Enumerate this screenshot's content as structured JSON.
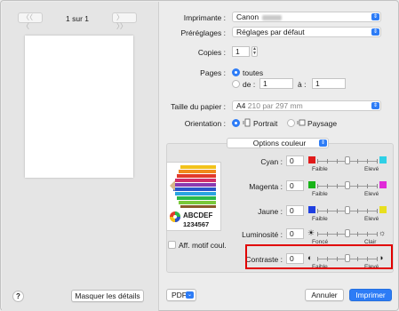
{
  "navigation": {
    "prev": "〈〈 〈",
    "next": "〉 〉〉",
    "page_label": "1 sur 1"
  },
  "printer": {
    "label": "Imprimante :",
    "value": "Canon"
  },
  "presets": {
    "label": "Préréglages :",
    "value": "Réglages par défaut"
  },
  "copies": {
    "label": "Copies :",
    "value": "1"
  },
  "pages": {
    "label": "Pages :",
    "all": "toutes",
    "from_label": "de :",
    "from": "1",
    "to_label": "à :",
    "to": "1"
  },
  "paper": {
    "label": "Taille du papier :",
    "value": "A4",
    "dims": "210 par 297 mm"
  },
  "orientation": {
    "label": "Orientation :",
    "portrait": "Portrait",
    "landscape": "Paysage"
  },
  "section": {
    "value": "Options couleur"
  },
  "sample_text": {
    "line1": "ABCDEF",
    "line2": "1234567"
  },
  "show_pattern": {
    "label": "Aff. motif coul."
  },
  "adjustments": {
    "cyan": {
      "label": "Cyan :",
      "value": "0",
      "low": "Faible",
      "high": "Elevé",
      "level": 0.5,
      "low_color": "#e01a1a",
      "high_color": "#2fd0e6"
    },
    "magenta": {
      "label": "Magenta :",
      "value": "0",
      "low": "Faible",
      "high": "Elevé",
      "level": 0.5,
      "low_color": "#18b418",
      "high_color": "#e02ad8"
    },
    "yellow": {
      "label": "Jaune :",
      "value": "0",
      "low": "Faible",
      "high": "Elevé",
      "level": 0.5,
      "low_color": "#1f3fe0",
      "high_color": "#e8df1f"
    },
    "brightness": {
      "label": "Luminosité :",
      "value": "0",
      "low": "Foncé",
      "high": "Clair",
      "level": 0.5
    },
    "contrast": {
      "label": "Contraste :",
      "value": "0",
      "low": "Faible",
      "high": "Elevé",
      "level": 0.5
    }
  },
  "footer": {
    "help": "?",
    "hide_details": "Masquer les détails",
    "pdf": "PDF",
    "cancel": "Annuler",
    "print": "Imprimer"
  },
  "colors": {
    "accent": "#2d7cf6",
    "highlight": "#e10000"
  }
}
